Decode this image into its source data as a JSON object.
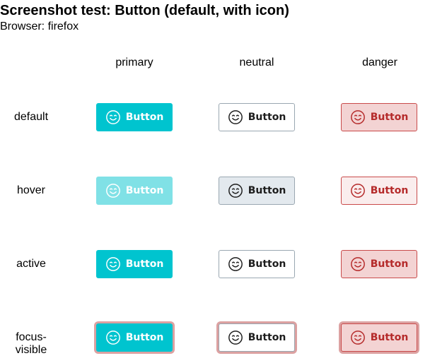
{
  "page": {
    "title": "Screenshot test: Button (default, with icon)",
    "browser_line": "Browser: firefox"
  },
  "columns": [
    "primary",
    "neutral",
    "danger"
  ],
  "rows": [
    "default",
    "hover",
    "active",
    "focus-visible"
  ],
  "button": {
    "label": "Button",
    "icon": "smiley-face-icon"
  },
  "colors": {
    "primary": "#00c4cf",
    "primary_hover": "#80e1e6",
    "neutral_border": "#9aa7b1",
    "neutral_hover": "#e3e9ee",
    "danger_bg": "#f3d3d3",
    "danger_border": "#c94a4a",
    "danger_text": "#b52a2a",
    "focus_ring": "#dca1a1"
  }
}
